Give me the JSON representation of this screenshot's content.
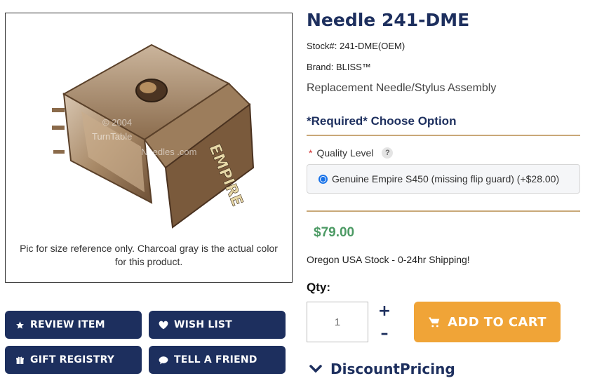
{
  "product": {
    "title": "Needle 241-DME",
    "stock_label": "Stock#:",
    "stock_value": "241-DME(OEM)",
    "brand_label": "Brand:",
    "brand_value": "BLISS™",
    "subtitle": "Replacement Needle/Stylus Assembly",
    "image_caption": "Pic for size reference only. Charcoal gray is the actual color for this product.",
    "image_watermark": "© 2004 TurnTable Needles.com",
    "image_brand_lettering": "EMPIRE"
  },
  "options": {
    "heading": "*Required* Choose Option",
    "required_marker": "*",
    "label": "Quality Level",
    "help": "?",
    "selected_option": "Genuine Empire S450 (missing flip guard) (+$28.00)"
  },
  "pricing": {
    "price": "$79.00",
    "shipping_note": "Oregon USA Stock - 0-24hr Shipping!"
  },
  "quantity": {
    "label": "Qty:",
    "placeholder": "1",
    "plus": "+",
    "minus": "–"
  },
  "actions": {
    "review": "REVIEW ITEM",
    "wish": "WISH LIST",
    "gift": "GIFT REGISTRY",
    "tell": "TELL A FRIEND",
    "add_to_cart": "ADD TO CART"
  },
  "discount": {
    "label": "DiscountPricing"
  },
  "colors": {
    "navy": "#1d2f5e",
    "orange": "#f0a437",
    "price_green": "#4c9a64",
    "divider_tan": "#c9a878"
  },
  "icons": {
    "review": "star-icon",
    "wish": "heart-icon",
    "gift": "gift-icon",
    "tell": "chat-bubble-icon",
    "cart": "cart-icon",
    "discount": "chevron-down-icon"
  }
}
